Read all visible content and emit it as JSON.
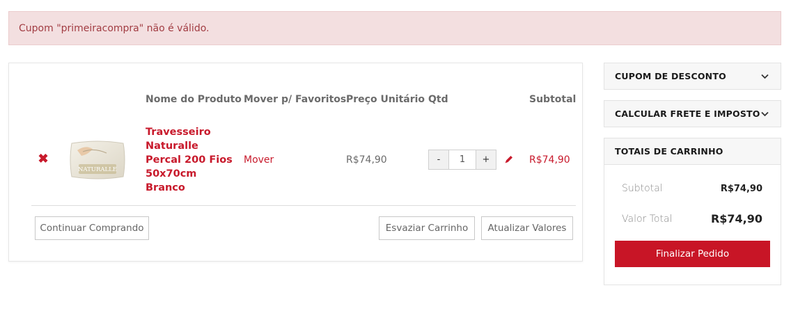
{
  "alert": {
    "message": "Cupom \"primeiracompra\" não é válido."
  },
  "cart": {
    "columns": {
      "product": "Nome do Produto",
      "favorites": "Mover p/ Favoritos",
      "unit_price": "Preço Unitário",
      "qty": "Qtd",
      "subtotal": "Subtotal"
    },
    "items": [
      {
        "name": "Travesseiro Naturalle Percal 200 Fios 50x70cm Branco",
        "thumb_text": "NATURALLE",
        "move_label": "Mover",
        "unit_price": "R$74,90",
        "qty": "1",
        "qty_minus": "-",
        "qty_plus": "+",
        "subtotal": "R$74,90",
        "remove_icon": "close-x-icon",
        "edit_icon": "pencil-icon"
      }
    ],
    "buttons": {
      "continue": "Continuar Comprando",
      "empty": "Esvaziar Carrinho",
      "update": "Atualizar Valores"
    }
  },
  "sidebar": {
    "coupon": {
      "title": "CUPOM DE DESCONTO"
    },
    "shipping": {
      "title": "CALCULAR FRETE E IMPOSTO"
    },
    "totals": {
      "title": "TOTAIS DE CARRINHO",
      "subtotal_label": "Subtotal",
      "subtotal_value": "R$74,90",
      "total_label": "Valor Total",
      "total_value": "R$74,90",
      "checkout_label": "Finalizar Pedido"
    }
  },
  "colors": {
    "accent": "#c81526",
    "alert_bg": "#f3dfe0",
    "alert_text": "#a23d43"
  }
}
